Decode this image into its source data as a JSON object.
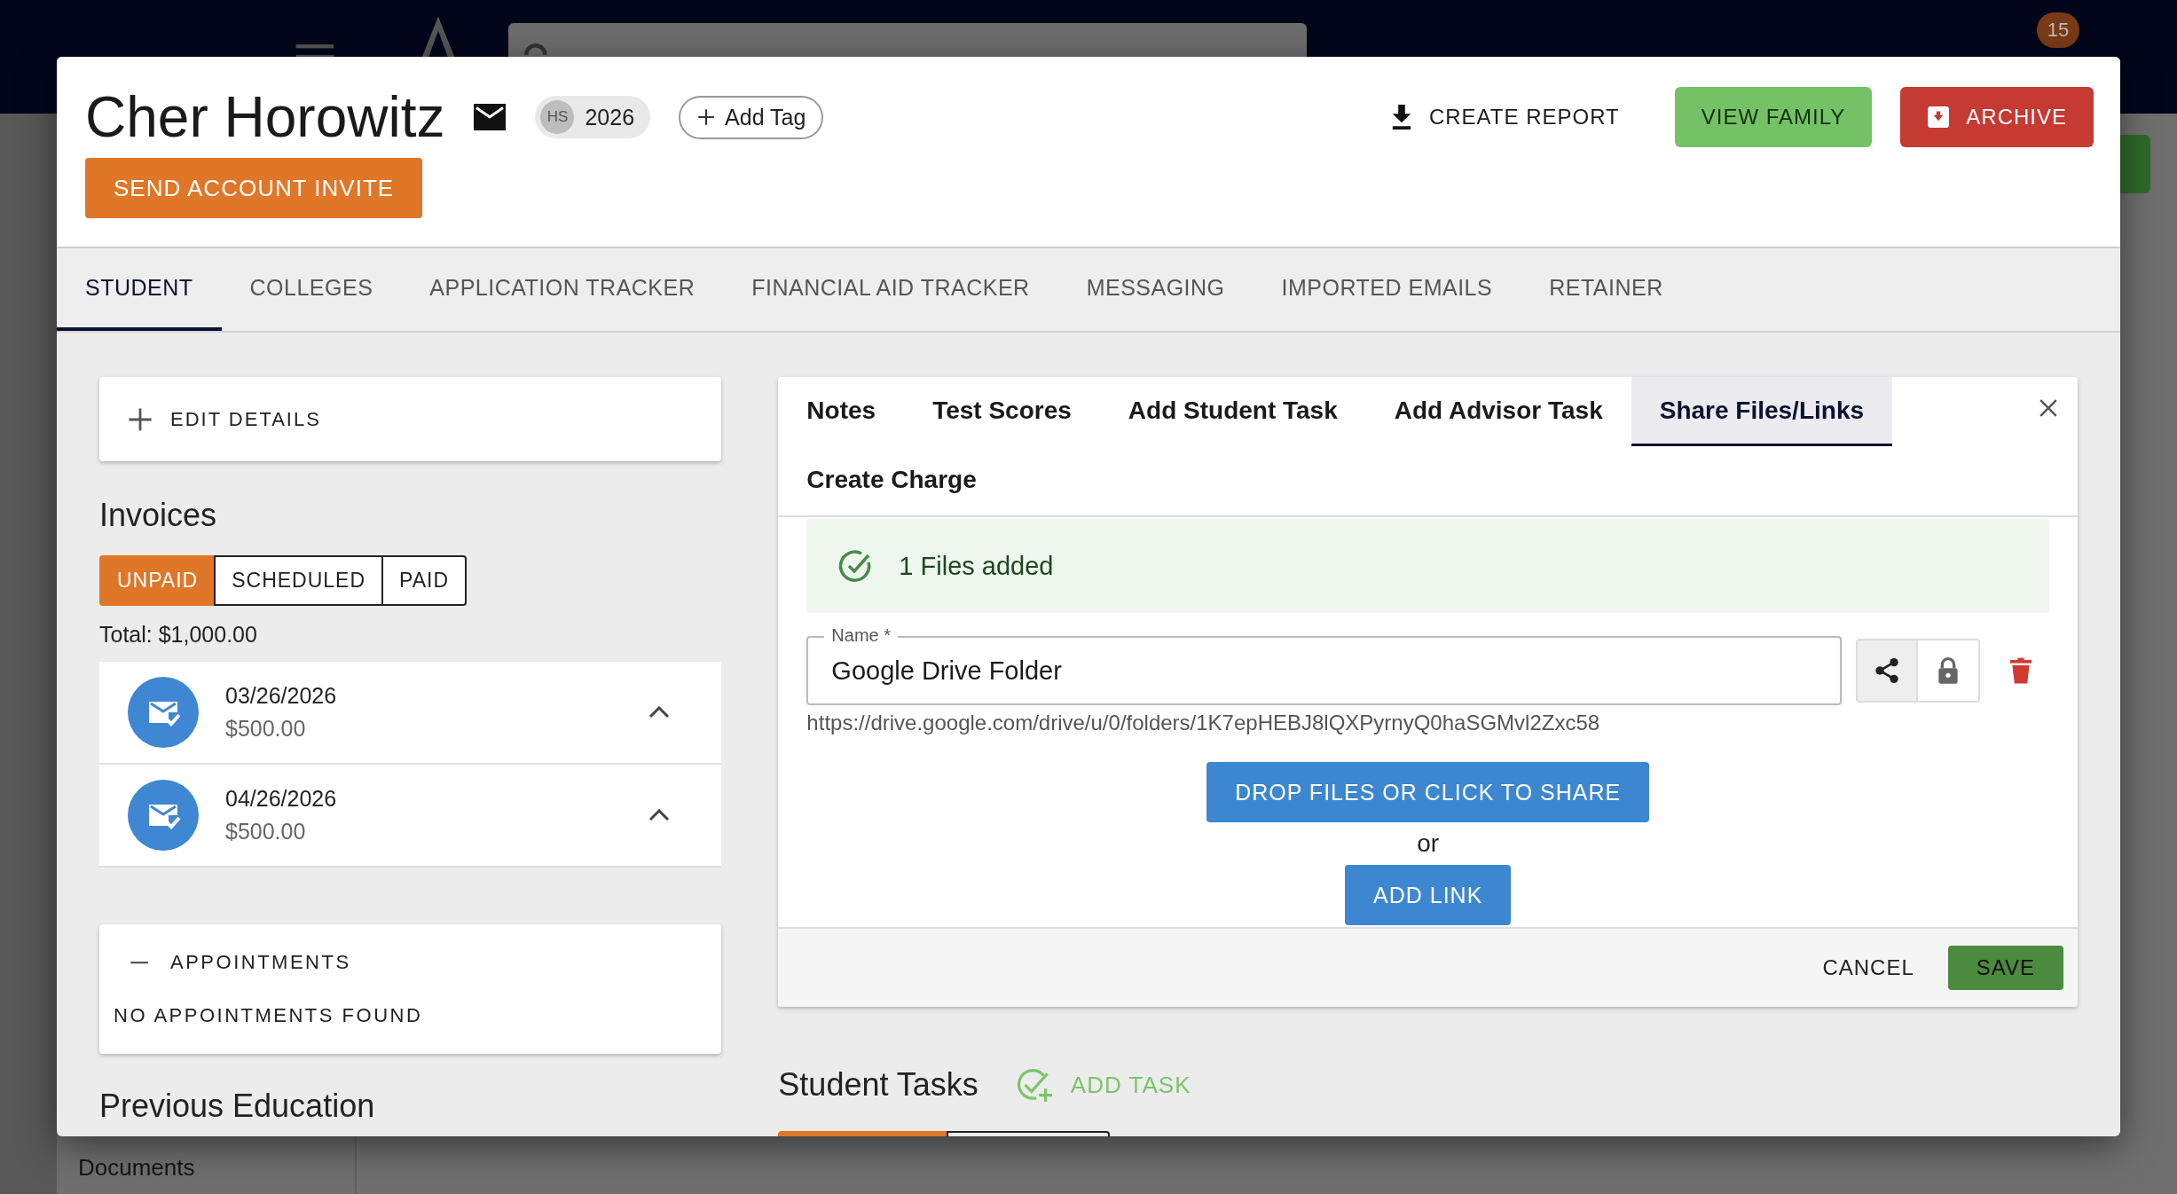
{
  "background": {
    "notification_count": "15",
    "sidebar_items": [
      {
        "label": "Documents"
      }
    ]
  },
  "header": {
    "name": "Cher Horowitz",
    "grad_badge": {
      "prefix": "HS",
      "year": "2026"
    },
    "add_tag": "Add Tag",
    "send_invite": "SEND ACCOUNT INVITE",
    "actions": [
      {
        "kind": "report",
        "label": "CREATE REPORT"
      },
      {
        "kind": "family",
        "label": "VIEW FAMILY"
      },
      {
        "kind": "archive",
        "label": "ARCHIVE"
      }
    ]
  },
  "tabs": [
    {
      "label": "STUDENT",
      "selected": true
    },
    {
      "label": "COLLEGES",
      "selected": false
    },
    {
      "label": "APPLICATION TRACKER",
      "selected": false
    },
    {
      "label": "FINANCIAL AID TRACKER",
      "selected": false
    },
    {
      "label": "MESSAGING",
      "selected": false
    },
    {
      "label": "IMPORTED EMAILS",
      "selected": false
    },
    {
      "label": "RETAINER",
      "selected": false
    }
  ],
  "left": {
    "edit_details": "EDIT DETAILS",
    "invoices": {
      "title": "Invoices",
      "filters": [
        {
          "label": "UNPAID",
          "selected": true
        },
        {
          "label": "SCHEDULED",
          "selected": false
        },
        {
          "label": "PAID",
          "selected": false
        }
      ],
      "total": "Total: $1,000.00",
      "items": [
        {
          "date": "03/26/2026",
          "amount": "$500.00"
        },
        {
          "date": "04/26/2026",
          "amount": "$500.00"
        }
      ]
    },
    "appointments": {
      "title": "APPOINTMENTS",
      "empty": "NO APPOINTMENTS FOUND"
    },
    "previous_education": "Previous Education"
  },
  "panel": {
    "tabs": [
      {
        "label": "Notes",
        "selected": false
      },
      {
        "label": "Test Scores",
        "selected": false
      },
      {
        "label": "Add Student Task",
        "selected": false
      },
      {
        "label": "Add Advisor Task",
        "selected": false
      },
      {
        "label": "Share Files/Links",
        "selected": true
      },
      {
        "label": "Create Charge",
        "selected": false
      }
    ],
    "alert": "1 Files added",
    "field": {
      "label": "Name *",
      "value": "Google Drive Folder"
    },
    "toggles": [
      {
        "kind": "share",
        "selected": true
      },
      {
        "kind": "lock",
        "selected": false
      }
    ],
    "url": "https://drive.google.com/drive/u/0/folders/1K7epHEBJ8lQXPyrnyQ0haSGMvl2Zxc58",
    "upload_button": "DROP FILES OR CLICK TO SHARE",
    "or": "or",
    "add_link": "ADD LINK",
    "cancel": "CANCEL",
    "save": "SAVE"
  },
  "tasks": {
    "title": "Student Tasks",
    "add": "ADD TASK"
  }
}
